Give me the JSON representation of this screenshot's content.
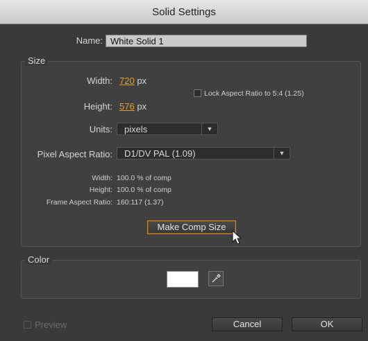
{
  "window": {
    "title": "Solid Settings"
  },
  "name": {
    "label": "Name:",
    "value": "White Solid 1"
  },
  "size": {
    "group_title": "Size",
    "width_label": "Width:",
    "width_value": "720",
    "width_unit": "px",
    "height_label": "Height:",
    "height_value": "576",
    "height_unit": "px",
    "lock_aspect_label": "Lock Aspect Ratio to 5:4 (1.25)",
    "lock_aspect_checked": false,
    "units_label": "Units:",
    "units_value": "pixels",
    "par_label": "Pixel Aspect Ratio:",
    "par_value": "D1/DV PAL (1.09)",
    "info_width_label": "Width:",
    "info_width_value": "100.0 % of comp",
    "info_height_label": "Height:",
    "info_height_value": "100.0 % of comp",
    "info_far_label": "Frame Aspect Ratio:",
    "info_far_value": "160:117 (1.37)",
    "make_comp_size_label": "Make Comp Size"
  },
  "color": {
    "group_title": "Color",
    "swatch_hex": "#ffffff"
  },
  "footer": {
    "preview_label": "Preview",
    "cancel_label": "Cancel",
    "ok_label": "OK"
  }
}
